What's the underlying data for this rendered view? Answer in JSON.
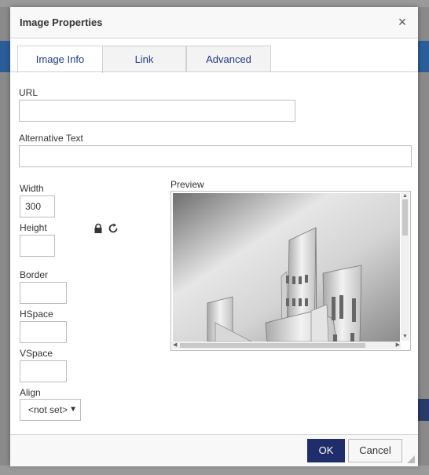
{
  "dialog": {
    "title": "Image Properties",
    "close_glyph": "×"
  },
  "tabs": [
    {
      "label": "Image Info",
      "active": true
    },
    {
      "label": "Link",
      "active": false
    },
    {
      "label": "Advanced",
      "active": false
    }
  ],
  "fields": {
    "url_label": "URL",
    "url_value": "",
    "alt_label": "Alternative Text",
    "alt_value": "",
    "width_label": "Width",
    "width_value": "300",
    "height_label": "Height",
    "height_value": "",
    "border_label": "Border",
    "border_value": "",
    "hspace_label": "HSpace",
    "hspace_value": "",
    "vspace_label": "VSpace",
    "vspace_value": "",
    "align_label": "Align",
    "align_value": "<not set>"
  },
  "icons": {
    "lock": "lock-icon",
    "reset": "reset-size-icon"
  },
  "preview": {
    "label": "Preview"
  },
  "buttons": {
    "ok": "OK",
    "cancel": "Cancel"
  },
  "colors": {
    "accent": "#1f2d6b",
    "tab_text": "#1e3a8a"
  }
}
